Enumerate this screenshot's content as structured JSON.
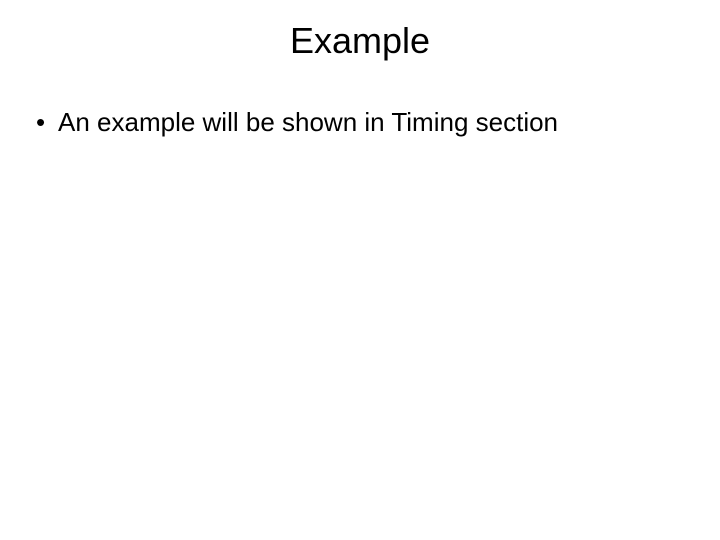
{
  "slide": {
    "title": "Example",
    "bullets": [
      "An example will be shown in Timing section"
    ]
  }
}
